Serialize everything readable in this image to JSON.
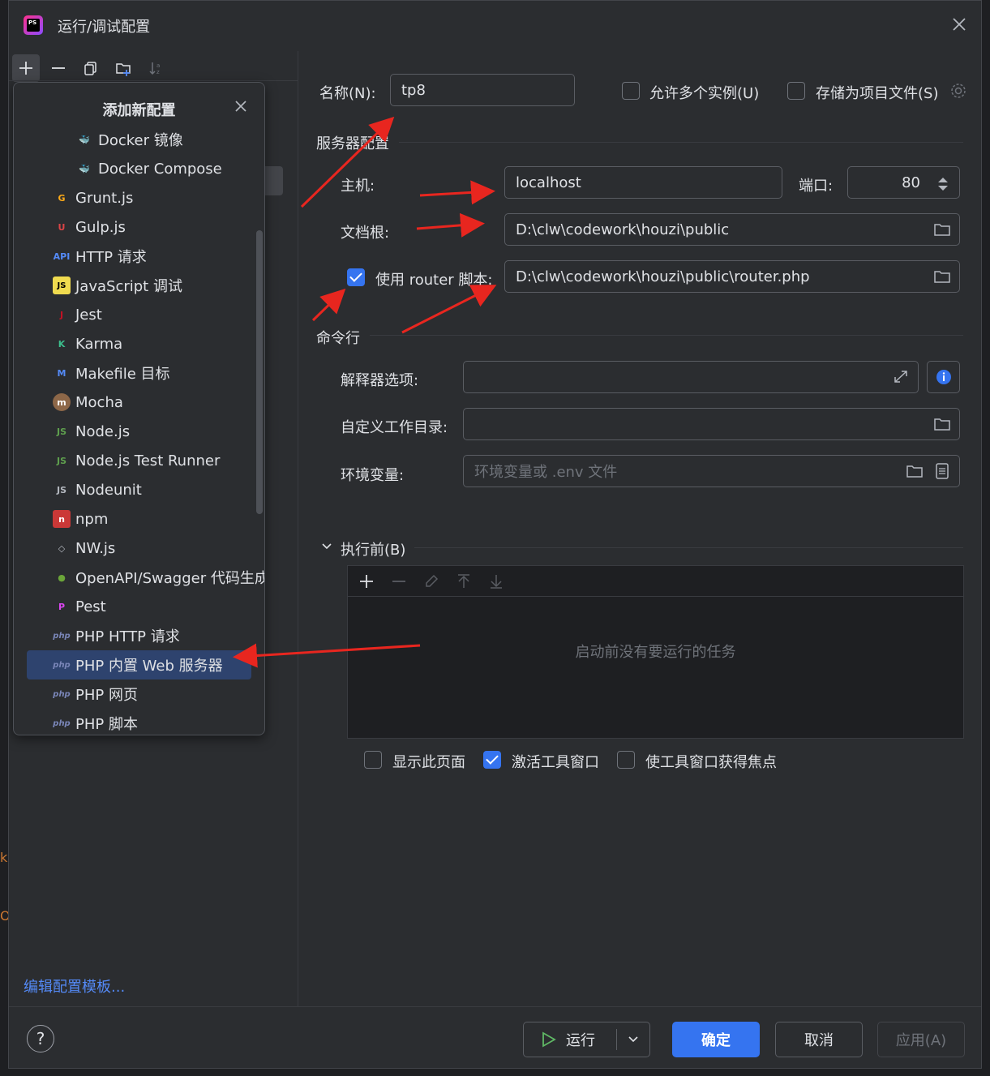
{
  "window": {
    "title": "运行/调试配置",
    "app_icon_text": "PS"
  },
  "toolbar": {
    "icons": [
      "add-icon",
      "remove-icon",
      "copy-icon",
      "folder-add-icon",
      "sort-icon"
    ]
  },
  "popup": {
    "title": "添加新配置",
    "items": [
      {
        "label": "Docker 镜像",
        "icon": "docker-icon",
        "sub": true
      },
      {
        "label": "Docker Compose",
        "icon": "docker-icon",
        "sub": true
      },
      {
        "label": "Grunt.js",
        "icon": "grunt-icon"
      },
      {
        "label": "Gulp.js",
        "icon": "gulp-icon"
      },
      {
        "label": "HTTP 请求",
        "icon": "api-icon"
      },
      {
        "label": "JavaScript 调试",
        "icon": "js-icon"
      },
      {
        "label": "Jest",
        "icon": "jest-icon"
      },
      {
        "label": "Karma",
        "icon": "karma-icon"
      },
      {
        "label": "Makefile 目标",
        "icon": "makefile-icon"
      },
      {
        "label": "Mocha",
        "icon": "mocha-icon"
      },
      {
        "label": "Node.js",
        "icon": "nodejs-icon"
      },
      {
        "label": "Node.js Test Runner",
        "icon": "nodejs-test-icon"
      },
      {
        "label": "Nodeunit",
        "icon": "nodeunit-icon"
      },
      {
        "label": "npm",
        "icon": "npm-icon"
      },
      {
        "label": "NW.js",
        "icon": "nwjs-icon"
      },
      {
        "label": "OpenAPI/Swagger 代码生成",
        "icon": "openapi-icon"
      },
      {
        "label": "Pest",
        "icon": "pest-icon"
      },
      {
        "label": "PHP HTTP 请求",
        "icon": "php-http-icon"
      },
      {
        "label": "PHP 内置 Web 服务器",
        "icon": "php-web-server-icon",
        "selected": true
      },
      {
        "label": "PHP 网页",
        "icon": "php-web-page-icon"
      },
      {
        "label": "PHP 脚本",
        "icon": "php-script-icon"
      }
    ]
  },
  "left": {
    "edit_template": "编辑配置模板..."
  },
  "form": {
    "name_label": "名称(N):",
    "name_value": "tp8",
    "allow_multiple": "允许多个实例(U)",
    "store_as_file": "存储为项目文件(S)",
    "server_section": "服务器配置",
    "host_label": "主机:",
    "host_value": "localhost",
    "port_label": "端口:",
    "port_value": "80",
    "docroot_label": "文档根:",
    "docroot_value": "D:\\clw\\codework\\houzi\\public",
    "router_label": "使用 router 脚本:",
    "router_value": "D:\\clw\\codework\\houzi\\public\\router.php",
    "cmd_section": "命令行",
    "interp_label": "解释器选项:",
    "interp_value": "",
    "workdir_label": "自定义工作目录:",
    "workdir_value": "",
    "env_label": "环境变量:",
    "env_placeholder": "环境变量或 .env 文件",
    "before_section": "执行前(B)",
    "tasks_empty": "启动前没有要运行的任务",
    "show_page": "显示此页面",
    "activate_tool": "激活工具窗口",
    "focus_tool": "使工具窗口获得焦点"
  },
  "buttons": {
    "help": "?",
    "run": "运行",
    "ok": "确定",
    "cancel": "取消",
    "apply": "应用(A)"
  },
  "colors": {
    "accent": "#3574f0",
    "arrow": "#e8261f",
    "background": "#2b2d30"
  }
}
